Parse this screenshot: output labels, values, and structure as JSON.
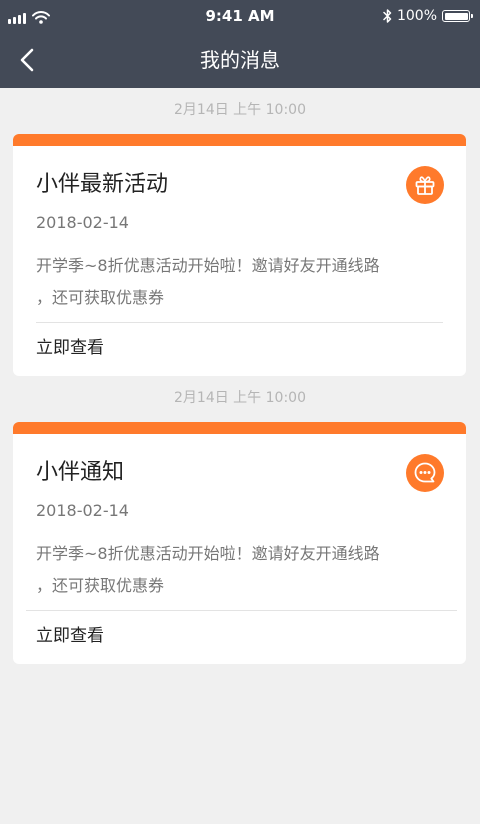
{
  "status_bar": {
    "time": "9:41 AM",
    "battery": "100%",
    "battery_level": 1.0
  },
  "nav": {
    "title": "我的消息",
    "back_icon": "chevron-left-icon"
  },
  "messages": [
    {
      "timestamp": "2月14日 上午 10:00",
      "title": "小伴最新活动",
      "date": "2018-02-14",
      "body_line1": "开学季~8折优惠活动开始啦！邀请好友开通线路",
      "body_line2": "，还可获取优惠券",
      "link": "立即查看",
      "icon": "gift-icon"
    },
    {
      "timestamp": "2月14日 上午 10:00",
      "title": "小伴通知",
      "date": "2018-02-14",
      "body_line1": "开学季~8折优惠活动开始啦！邀请好友开通线路",
      "body_line2": "，还可获取优惠券",
      "link": "立即查看",
      "icon": "chat-bubble-icon"
    }
  ],
  "colors": {
    "header_bg": "#434a57",
    "accent": "#ff7a2b",
    "page_bg": "#f0f0f0"
  }
}
